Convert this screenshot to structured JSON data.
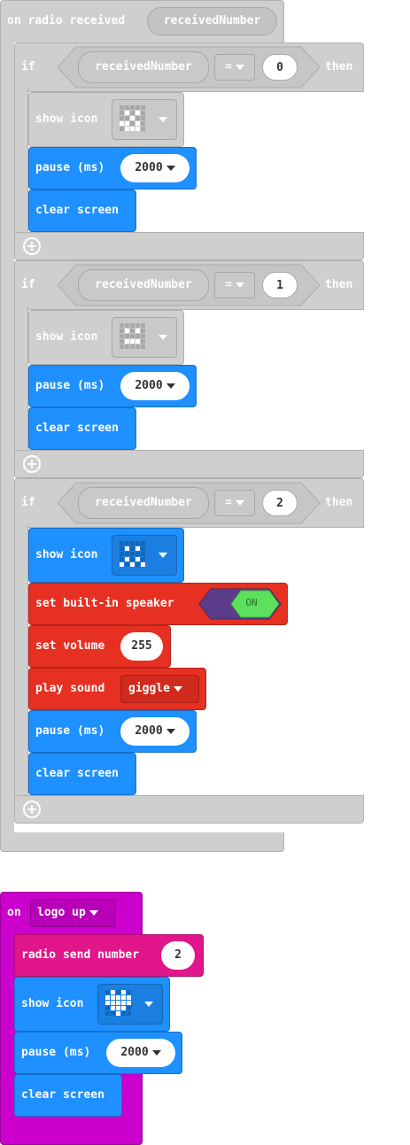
{
  "event_radio": {
    "label": "on radio received",
    "param": "receivedNumber"
  },
  "if_blocks": [
    {
      "if_label": "if",
      "then_label": "then",
      "variable": "receivedNumber",
      "operator": "=",
      "value": "0",
      "show_icon_label": "show icon",
      "pause_label": "pause (ms)",
      "pause_value": "2000",
      "clear_label": "clear screen"
    },
    {
      "if_label": "if",
      "then_label": "then",
      "variable": "receivedNumber",
      "operator": "=",
      "value": "1",
      "show_icon_label": "show icon",
      "pause_label": "pause (ms)",
      "pause_value": "2000",
      "clear_label": "clear screen"
    },
    {
      "if_label": "if",
      "then_label": "then",
      "variable": "receivedNumber",
      "operator": "=",
      "value": "2",
      "show_icon_label": "show icon",
      "speaker_label": "set built-in speaker",
      "speaker_toggle": "ON",
      "volume_label": "set volume",
      "volume_value": "255",
      "sound_label": "play sound",
      "sound_value": "giggle",
      "pause_label": "pause (ms)",
      "pause_value": "2000",
      "clear_label": "clear screen"
    }
  ],
  "event_logo": {
    "label": "on",
    "option": "logo up",
    "radio_send_label": "radio send number",
    "radio_send_value": "2",
    "show_icon_label": "show icon",
    "pause_label": "pause (ms)",
    "pause_value": "2000",
    "clear_label": "clear screen"
  },
  "colors": {
    "disabled_gray": "#cfcfcf",
    "basic_blue": "#1e90ff",
    "music_red": "#e63022",
    "input_magenta": "#cc00cc",
    "radio_pink": "#e0168a",
    "toggle_green": "#5ce15c",
    "toggle_purple": "#5a3c8a"
  }
}
